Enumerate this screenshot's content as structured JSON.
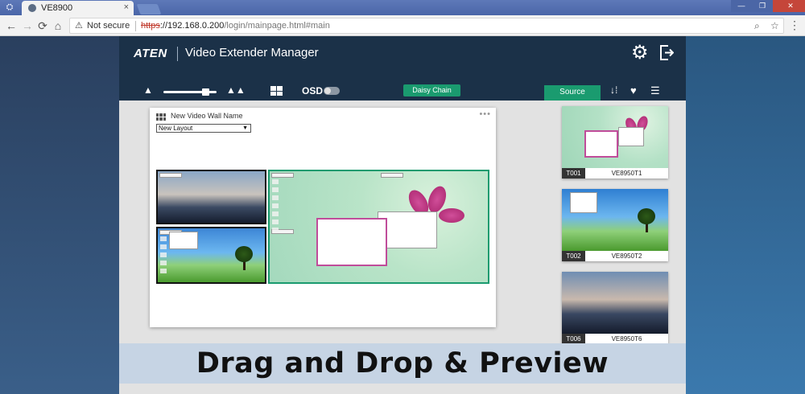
{
  "browser": {
    "tab_title": "VE8900",
    "tab_close": "×",
    "security_label": "Not secure",
    "url_scheme": "https",
    "url_host": "://192.168.0.200",
    "url_path": "/login/mainpage.html#main",
    "nav_back": "←",
    "nav_forward": "→",
    "nav_reload": "⟳",
    "nav_home": "⌂",
    "zoom_icon": "⌕",
    "bookmark_icon": "☆",
    "menu_icon": "⋮"
  },
  "app": {
    "logo": "ATEN",
    "title": "Video Extender Manager",
    "osd_label": "OSD",
    "osd_enabled": false,
    "brightness_level": 0.85,
    "daisy_chain_label": "Daisy Chain",
    "source_tab_label": "Source",
    "icons": {
      "settings": "gear-icon",
      "logout": "logout-icon",
      "sort": "sort-icon",
      "favorite": "heart-icon",
      "list": "list-icon"
    }
  },
  "video_wall": {
    "name": "New Video Wall Name",
    "layout_value": "New Layout",
    "more_label": "•••"
  },
  "sources": [
    {
      "id": "T001",
      "name": "VE8950T1"
    },
    {
      "id": "T002",
      "name": "VE8950T2"
    },
    {
      "id": "T006",
      "name": "VE8950T6"
    }
  ],
  "banner": {
    "text": "Drag and Drop  &  Preview"
  },
  "colors": {
    "accent": "#1a9b6f",
    "header": "#1b3148",
    "banner": "#c6d4e4"
  }
}
